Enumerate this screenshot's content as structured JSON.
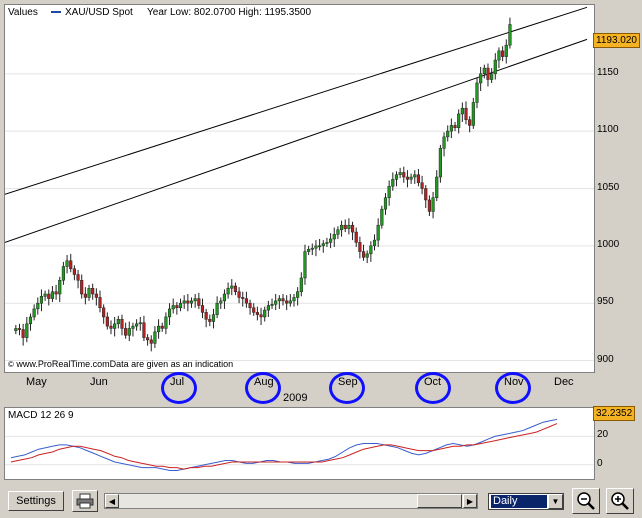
{
  "header": {
    "values_label": "Values",
    "instrument": "XAU/USD Spot",
    "year_range": "Year Low: 802.0700 High: 1195.3500"
  },
  "watermark": "www.ProRealTime.comData are given as an indication",
  "last_price_tag": "1193.020",
  "year_label": "2009",
  "macd": {
    "label": "MACD 12 26 9",
    "value_tag": "32.2352",
    "ticks": [
      "20",
      "0"
    ]
  },
  "toolbar": {
    "settings_label": "Settings",
    "period_value": "Daily"
  },
  "colors": {
    "up_candle": "#1f9a1f",
    "down_candle": "#b22222",
    "macd_line": "#3a5fcd",
    "signal_line": "#cc2222",
    "annotation_circle": "#1010ff",
    "price_tag": "#f5b324"
  },
  "chart_data": [
    {
      "type": "candlestick",
      "series_name": "XAU/USD Spot",
      "x_tick_labels": [
        "May",
        "Jun",
        "Jul",
        "Aug",
        "Sep",
        "Oct",
        "Nov",
        "Dec"
      ],
      "circled_ticks": [
        "Jul",
        "Aug",
        "Sep",
        "Oct",
        "Nov"
      ],
      "y_ticks": [
        900,
        950,
        1000,
        1050,
        1100,
        1150
      ],
      "ylim": [
        890,
        1210
      ],
      "last_price": 1193.02,
      "trend_channel": [
        {
          "from": {
            "date": "2009-04-27",
            "value": 1045
          },
          "to": {
            "date": "2009-11-30",
            "value": 1208
          }
        },
        {
          "from": {
            "date": "2009-04-27",
            "value": 1003
          },
          "to": {
            "date": "2009-11-30",
            "value": 1180
          }
        }
      ],
      "closes": [
        928,
        927,
        920,
        932,
        938,
        945,
        950,
        956,
        958,
        954,
        960,
        958,
        970,
        982,
        987,
        980,
        975,
        970,
        958,
        955,
        963,
        958,
        955,
        946,
        938,
        930,
        928,
        932,
        936,
        928,
        922,
        928,
        930,
        932,
        933,
        920,
        918,
        915,
        925,
        930,
        928,
        938,
        945,
        948,
        946,
        950,
        952,
        950,
        952,
        954,
        948,
        942,
        936,
        934,
        940,
        950,
        952,
        958,
        963,
        965,
        960,
        955,
        954,
        950,
        946,
        942,
        940,
        938,
        944,
        948,
        949,
        952,
        954,
        952,
        950,
        952,
        955,
        960,
        972,
        995,
        997,
        998,
        1000,
        1000,
        1002,
        1003,
        1006,
        1010,
        1014,
        1018,
        1015,
        1018,
        1012,
        1003,
        995,
        990,
        993,
        1000,
        1005,
        1018,
        1032,
        1042,
        1052,
        1058,
        1062,
        1064,
        1060,
        1058,
        1060,
        1062,
        1055,
        1050,
        1040,
        1030,
        1042,
        1060,
        1085,
        1095,
        1100,
        1105,
        1103,
        1115,
        1120,
        1110,
        1105,
        1125,
        1142,
        1150,
        1155,
        1145,
        1150,
        1162,
        1170,
        1165,
        1175,
        1193
      ]
    },
    {
      "type": "line",
      "title": "MACD 12 26 9",
      "y_ticks": [
        0,
        20
      ],
      "ylim": [
        -10,
        40
      ],
      "last_value": 32.2352,
      "series": [
        {
          "name": "MACD",
          "values": [
            5,
            6,
            7,
            9,
            11,
            12,
            13,
            14,
            14,
            13,
            12,
            10,
            8,
            6,
            4,
            2,
            1,
            0,
            -1,
            -2,
            -2,
            -2,
            -3,
            -4,
            -4,
            -3,
            -2,
            -1,
            0,
            1,
            2,
            3,
            3,
            2,
            1,
            1,
            2,
            3,
            3,
            2,
            2,
            1,
            1,
            1,
            2,
            3,
            4,
            6,
            9,
            12,
            14,
            15,
            15,
            15,
            14,
            13,
            12,
            10,
            8,
            7,
            8,
            10,
            12,
            14,
            15,
            14,
            13,
            14,
            16,
            18,
            20,
            21,
            22,
            23,
            24,
            26,
            28,
            30,
            31,
            32
          ]
        },
        {
          "name": "Signal",
          "values": [
            2,
            3,
            4,
            5,
            7,
            8,
            9,
            11,
            12,
            13,
            13,
            12,
            11,
            10,
            8,
            6,
            5,
            3,
            2,
            1,
            0,
            -1,
            -1,
            -2,
            -2,
            -3,
            -2,
            -2,
            -1,
            -1,
            0,
            1,
            2,
            2,
            2,
            2,
            2,
            2,
            2,
            2,
            2,
            2,
            2,
            2,
            2,
            2,
            3,
            4,
            5,
            7,
            9,
            11,
            12,
            13,
            14,
            14,
            13,
            12,
            11,
            10,
            10,
            10,
            11,
            12,
            13,
            13,
            14,
            14,
            15,
            16,
            17,
            18,
            19,
            20,
            21,
            22,
            23,
            25,
            27,
            29
          ]
        }
      ]
    }
  ]
}
